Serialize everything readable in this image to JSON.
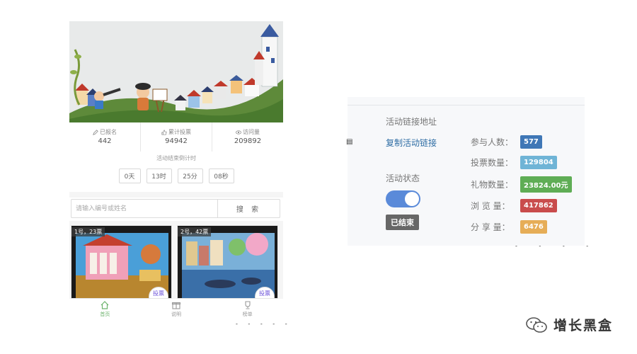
{
  "mobile": {
    "stats": [
      {
        "label": "已报名",
        "value": "442",
        "icon": "pencil-icon"
      },
      {
        "label": "累计投票",
        "value": "94942",
        "icon": "thumbs-up-icon"
      },
      {
        "label": "访问量",
        "value": "209892",
        "icon": "eye-icon"
      }
    ],
    "countdown_label": "活动结束倒计时",
    "countdown": [
      "0天",
      "13时",
      "25分",
      "08秒"
    ],
    "search": {
      "placeholder": "请输入编号或姓名",
      "button_label": "搜 索"
    },
    "cards": [
      {
        "tag": "1号，23票",
        "vote_label": "投票"
      },
      {
        "tag": "2号，42票",
        "vote_label": "投票"
      }
    ],
    "tabs": [
      {
        "label": "首页",
        "icon": "home-icon",
        "active": true
      },
      {
        "label": "说明",
        "icon": "gift-icon",
        "active": false
      },
      {
        "label": "榜单",
        "icon": "trophy-icon",
        "active": false
      }
    ],
    "accent_color": "#6db36d"
  },
  "admin": {
    "link_title": "活动链接地址",
    "copy_link_label": "复制活动链接",
    "status_title": "活动状态",
    "status_toggle_on": true,
    "status_badge": "已结束",
    "metrics": [
      {
        "label": "参与人数：",
        "value": "577",
        "color": "#3f77b6"
      },
      {
        "label": "投票数量：",
        "value": "129804",
        "color": "#6fb4d6"
      },
      {
        "label": "礼物数量：",
        "value": "23824.00元",
        "color": "#5fad55"
      },
      {
        "label": "浏 览 量：",
        "value": "417862",
        "color": "#c94c4c"
      },
      {
        "label": "分 享 量：",
        "value": "6476",
        "color": "#e6ad57"
      }
    ],
    "toggle_color": "#5a8ad9"
  },
  "watermark": {
    "text": "增长黑盒",
    "icon": "wechat-icon"
  }
}
